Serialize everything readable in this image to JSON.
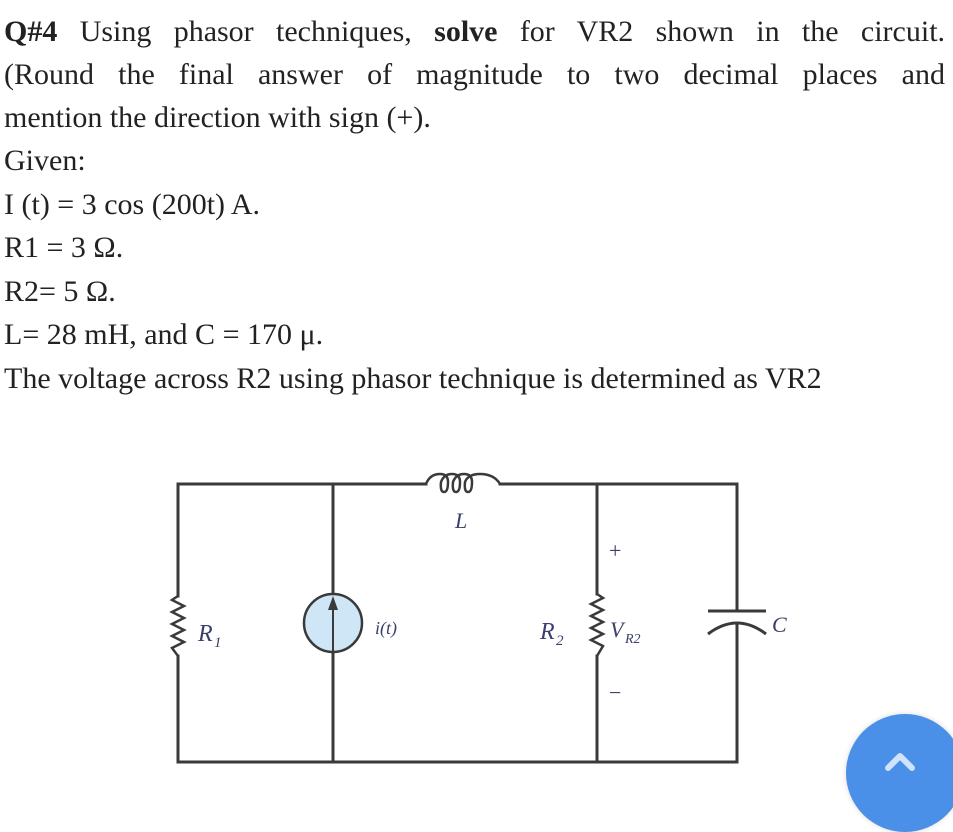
{
  "question": {
    "number_label": "Q#4",
    "line1_a": "Using phasor techniques,",
    "line1_bold": "solve",
    "line1_b": "for VR2 shown in the circuit.",
    "line2": "(Round the final answer of magnitude to two decimal places and",
    "line3": "mention the direction with sign (+)."
  },
  "given": {
    "heading": "Given:",
    "items": [
      "I (t) = 3 cos (200t) A.",
      "R1 = 3 Ω.",
      "R2= 5 Ω.",
      "L= 28 mH, and   C = 170 μ."
    ],
    "conclusion": "The voltage across R2 using phasor technique is determined as VR2"
  },
  "circuit": {
    "labels": {
      "r1": "R",
      "r1_sub": "1",
      "source": "i(t)",
      "inductor": "L",
      "r2": "R",
      "r2_sub": "2",
      "vr2": "V",
      "vr2_sub": "R2",
      "plus": "+",
      "minus": "−",
      "capacitor": "C"
    },
    "colors": {
      "wire": "#3a3a3a",
      "label": "#3b3f6b",
      "source_fill": "#cfe6f7"
    }
  },
  "fab": {
    "icon": "chevron-up-icon",
    "color": "#4a90e8"
  }
}
